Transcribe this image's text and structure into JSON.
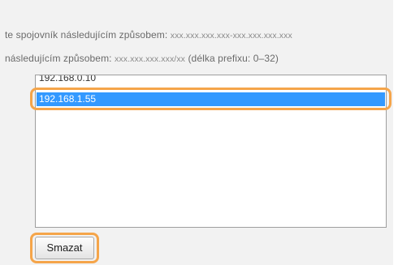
{
  "instructions": {
    "line1_text": "te spojovník následujícím způsobem: ",
    "line1_format": "xxx.xxx.xxx.xxx-xxx.xxx.xxx.xxx",
    "line2_text": "následujícím způsobem: ",
    "line2_format": "xxx.xxx.xxx.xxx/xx",
    "line2_suffix": " (délka prefixu: 0–32)"
  },
  "address_list": {
    "items": [
      "192.168.0.10",
      "192.168.1.55"
    ],
    "selected_index": 1
  },
  "actions": {
    "delete_label": "Smazat"
  },
  "colors": {
    "selection": "#3399ff",
    "highlight_ring": "#f5a54a",
    "panel_background": "#f2f2f2"
  }
}
